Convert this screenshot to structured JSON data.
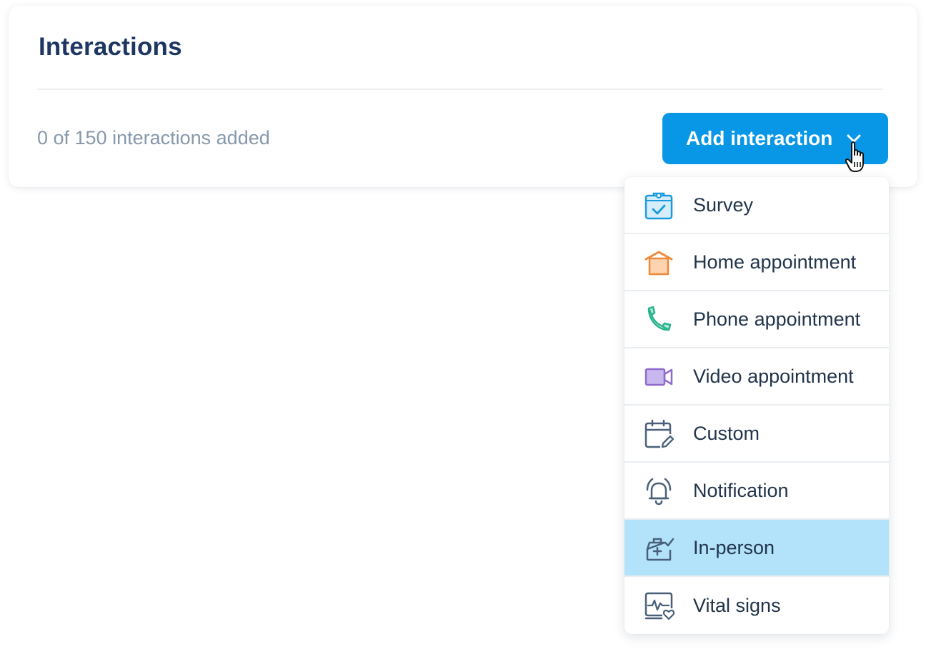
{
  "card": {
    "title": "Interactions",
    "count_text": "0 of 150 interactions added"
  },
  "add_button": {
    "label": "Add interaction",
    "color": "#0797e6"
  },
  "menu": {
    "items": [
      {
        "label": "Survey",
        "icon": "clipboard-check-icon",
        "color": "#1a9be0"
      },
      {
        "label": "Home appointment",
        "icon": "home-icon",
        "color": "#ee8a3a"
      },
      {
        "label": "Phone appointment",
        "icon": "phone-icon",
        "color": "#2bb38f"
      },
      {
        "label": "Video appointment",
        "icon": "video-camera-icon",
        "color": "#8f6bcf"
      },
      {
        "label": "Custom",
        "icon": "calendar-edit-icon",
        "color": "#4a607a"
      },
      {
        "label": "Notification",
        "icon": "bell-ring-icon",
        "color": "#4a607a"
      },
      {
        "label": "In-person",
        "icon": "medical-kit-icon",
        "color": "#4a607a",
        "highlighted": true
      },
      {
        "label": "Vital signs",
        "icon": "heart-monitor-icon",
        "color": "#4a607a"
      }
    ],
    "highlight_color": "#b3e2fb"
  }
}
